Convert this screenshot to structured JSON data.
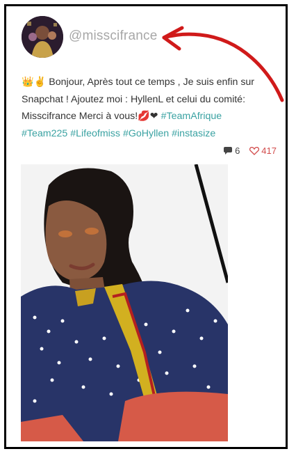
{
  "post": {
    "username": "@misscifrance",
    "caption": {
      "emoji_prefix": "👑✌",
      "text": "Bonjour, Après tout ce temps , Je suis enfin sur Snapchat ! Ajoutez moi : HyllenL et celui du comité: Misscifrance Merci à vous!",
      "emoji_suffix": "💋❤",
      "hashtags": [
        "#TeamAfrique",
        "#Team225",
        "#Lifeofmiss",
        "#GoHyllen",
        "#instasize"
      ]
    },
    "comments_count": "6",
    "likes_count": "417"
  },
  "colors": {
    "hashtag": "#3aa2a2",
    "likes": "#d24b4b",
    "arrow": "#d01a1a",
    "username": "#a7a7a7"
  },
  "icons": [
    "avatar",
    "comment-icon",
    "heart-icon",
    "red-arrow"
  ]
}
